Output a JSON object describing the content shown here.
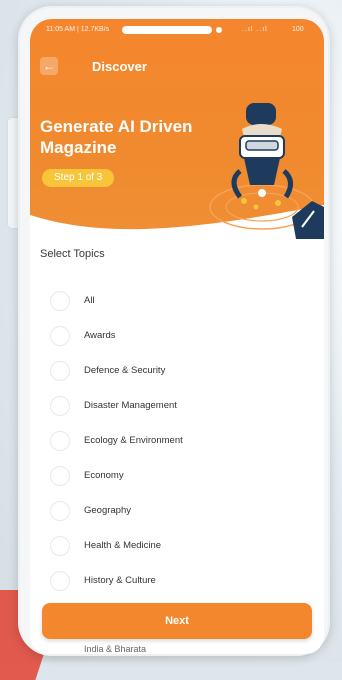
{
  "status": {
    "time": "11:05 AM | 12.7KB/s",
    "signal": "..ıl ..ıl",
    "battery": "100"
  },
  "header": {
    "title": "Discover",
    "back_icon": "arrow-left-icon"
  },
  "hero": {
    "title": "Generate AI Driven Magazine",
    "step": "Step 1 of 3"
  },
  "section": {
    "title": "Select Topics"
  },
  "topics": [
    "All",
    "Awards",
    "Defence & Security",
    "Disaster Management",
    "Ecology & Environment",
    "Economy",
    "Geography",
    "Health & Medicine",
    "History & Culture"
  ],
  "peek_topic": "India & Bharata",
  "actions": {
    "next": "Next"
  },
  "colors": {
    "primary": "#f3872d",
    "badge": "#f7c43a",
    "illustration_dark": "#1e3a5c"
  }
}
